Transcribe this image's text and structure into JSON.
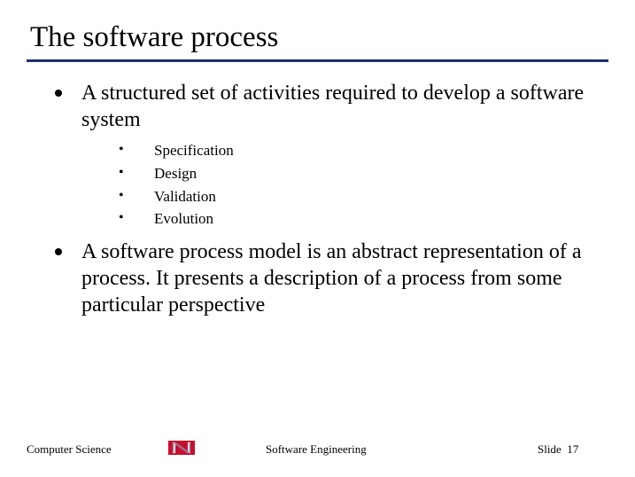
{
  "title": "The software process",
  "bullets": [
    {
      "text": "A structured set of activities required to develop a software system",
      "sub": [
        "Specification",
        "Design",
        "Validation",
        "Evolution"
      ]
    },
    {
      "text": "A software process model is an abstract representation of a process. It presents a description of a process from some particular perspective",
      "sub": []
    }
  ],
  "footer": {
    "left": "Computer Science",
    "center": "Software Engineering",
    "right_label": "Slide",
    "slide_number": "17"
  }
}
